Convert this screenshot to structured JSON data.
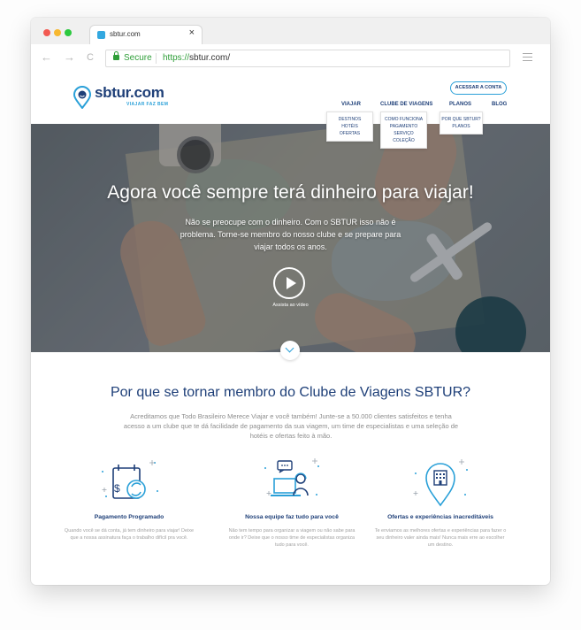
{
  "browser": {
    "tab_title": "sbtur.com",
    "tab_close": "×",
    "secure_label": "Secure",
    "url_protocol": "https://",
    "url_host": "sbtur.com/",
    "nav_back": "←",
    "nav_forward": "→",
    "nav_reload": "C"
  },
  "site": {
    "logo_text": "sbtur.com",
    "logo_tagline": "VIAJAR FAZ BEM",
    "login_label": "ACESSAR A CONTA",
    "nav": [
      {
        "label": "VIAJAR",
        "items": [
          "DESTINOS",
          "HOTÉIS",
          "OFERTAS"
        ]
      },
      {
        "label": "CLUBE DE VIAGENS",
        "items": [
          "COMO FUNCIONA",
          "PAGAMENTO",
          "SERVIÇO",
          "COLEÇÃO"
        ]
      },
      {
        "label": "PLANOS",
        "items": [
          "POR QUE SBTUR?",
          "PLANOS"
        ]
      },
      {
        "label": "BLOG",
        "items": []
      }
    ]
  },
  "hero": {
    "title": "Agora você sempre terá dinheiro para viajar!",
    "subtitle": "Não se preocupe com o dinheiro. Com o SBTUR isso não é problema. Torne-se membro do nosso clube e se prepare para viajar todos os anos.",
    "video_label": "Assista ao vídeo"
  },
  "why": {
    "title": "Por que se tornar membro do Clube de Viagens SBTUR?",
    "description": "Acreditamos que Todo Brasileiro Merece Viajar e você também! Junte-se a 50.000 clientes satisfeitos e tenha acesso a um clube que te dá facilidade de pagamento da sua viagem, um time de especialistas e uma seleção de hotéis e ofertas feito à mão."
  },
  "features": [
    {
      "icon": "calendar-money-icon",
      "title": "Pagamento Programado",
      "text": "Quando você se dá conta, já tem dinheiro para viajar! Deixe que a nossa assinatura faça o trabalho difícil pra você."
    },
    {
      "icon": "support-agent-icon",
      "title": "Nossa equipe faz tudo para você",
      "text": "Não tem tempo para organizar a viagem ou não sabe para onde ir? Deixe que o nosso time de especialistas organiza tudo para você."
    },
    {
      "icon": "location-hotel-icon",
      "title": "Ofertas e experiências inacreditáveis",
      "text": "Te enviamos as melhores ofertas e experiências para fazer o seu dinheiro valer ainda mais! Nunca mais erre ao escolher um destino."
    }
  ],
  "colors": {
    "brand_dark": "#1e3f78",
    "brand_light": "#2aa0d8",
    "secure_green": "#2e9e38"
  }
}
